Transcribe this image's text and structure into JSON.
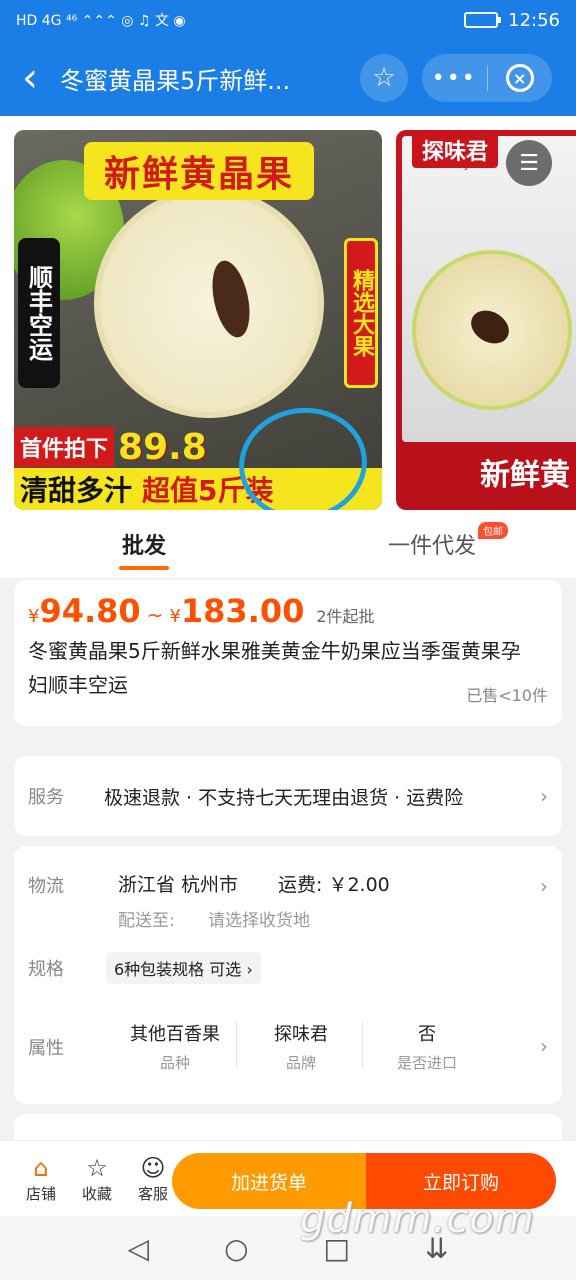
{
  "statusbar": {
    "left": "HD 4G ⁴⁶ ⌃⌃⌃ ◎ ♫ 文 ◉",
    "time": "12:56"
  },
  "nav": {
    "back": "‹",
    "title": "冬蜜黄晶果5斤新鲜...",
    "star": "☆",
    "more": "•••",
    "close": "×"
  },
  "gallery": {
    "img1": {
      "banner": "新鲜黄晶果",
      "left_tag": "顺丰空运",
      "right_tag": "精选大果",
      "price_label": "首件拍下",
      "price": "89.8",
      "bottom_a": "清甜多汁",
      "bottom_b": "超值5斤装"
    },
    "img2": {
      "brand": "探味君",
      "brand_sub": "TAN WEI JUN",
      "text": "新鲜黄"
    }
  },
  "tabs": [
    {
      "label": "批发"
    },
    {
      "label": "一件代发",
      "badge": "包邮"
    }
  ],
  "price": {
    "currency": "¥",
    "low": "94.80",
    "tilde": "~",
    "high": "183.00",
    "min_buy": "2件起批"
  },
  "product": {
    "title": "冬蜜黄晶果5斤新鲜水果雅美黄金牛奶果应当季蛋黄果孕妇顺丰空运",
    "sold": "已售<10件"
  },
  "service": {
    "label": "服务",
    "text": "极速退款 · 不支持七天无理由退货 · 运费险"
  },
  "logistics": {
    "label": "物流",
    "location": "浙江省 杭州市",
    "fee": "运费: ￥2.00",
    "to_label": "配送至:",
    "to_value": "请选择收货地"
  },
  "spec": {
    "label": "规格",
    "chip": "6种包装规格 可选 ›"
  },
  "attributes": {
    "label": "属性",
    "items": [
      {
        "value": "其他百香果",
        "key": "品种"
      },
      {
        "value": "探味君",
        "key": "品牌"
      },
      {
        "value": "否",
        "key": "是否进口"
      }
    ]
  },
  "actions": {
    "store": "店铺",
    "favorite": "收藏",
    "service": "客服",
    "add_cart": "加进货单",
    "buy_now": "立即订购"
  },
  "watermark": "gdmm.com",
  "system_nav": {
    "back": "◁",
    "home": "○",
    "recent": "□",
    "down": "⇊"
  }
}
